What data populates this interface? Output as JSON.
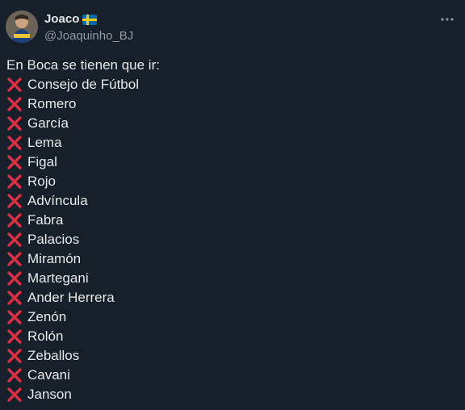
{
  "author": {
    "display_name": "Joaco",
    "handle": "@Joaquinho_BJ",
    "name_emoji": "sweden-flag-icon",
    "avatar": "avatar"
  },
  "menu": {
    "icon": "more-options-icon"
  },
  "tweet": {
    "intro": "En Boca se tienen que ir:",
    "bullet_icon": "cross-mark-icon",
    "items": [
      "Consejo de Fútbol",
      "Romero",
      "García",
      "Lema",
      "Figal",
      "Rojo",
      "Advíncula",
      "Fabra",
      "Palacios",
      "Miramón",
      "Martegani",
      "Ander Herrera",
      "Zenón",
      "Rolón",
      "Zeballos",
      "Cavani",
      "Janson"
    ]
  },
  "colors": {
    "background": "#15202b",
    "text": "#e7e9ea",
    "secondary_text": "#8b98a5",
    "cross": "#dd2e44"
  }
}
